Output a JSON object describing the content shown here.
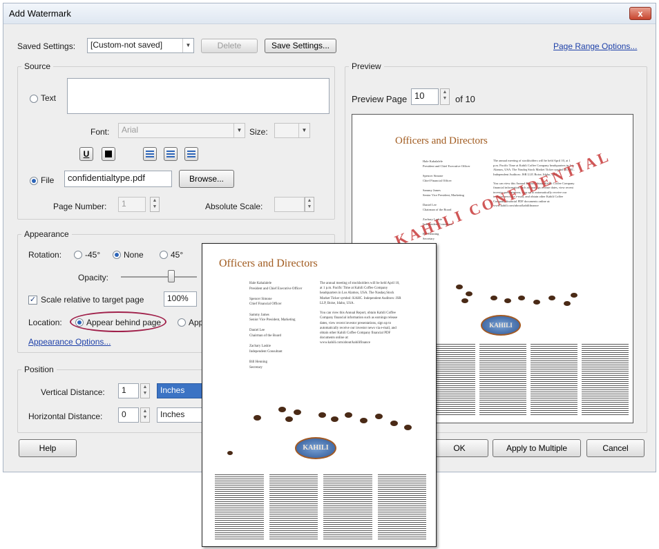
{
  "window": {
    "title": "Add Watermark",
    "close_glyph": "x"
  },
  "saved_settings": {
    "label": "Saved Settings:",
    "value": "[Custom-not saved]",
    "delete_label": "Delete",
    "save_label": "Save Settings..."
  },
  "page_range_link": "Page Range Options...",
  "source": {
    "title": "Source",
    "text_label": "Text",
    "font_label": "Font:",
    "font_value": "Arial",
    "size_label": "Size:",
    "underline_glyph": "U",
    "file_label": "File",
    "file_value": "confidentialtype.pdf",
    "browse_label": "Browse...",
    "page_number_label": "Page Number:",
    "page_number_value": "1",
    "absolute_scale_label": "Absolute Scale:"
  },
  "appearance": {
    "title": "Appearance",
    "rotation_label": "Rotation:",
    "rot_minus45": "-45°",
    "rot_none": "None",
    "rot_45": "45°",
    "opacity_label": "Opacity:",
    "opacity_percent": 15,
    "scale_label": "Scale relative to target page",
    "scale_value": "100%",
    "location_label": "Location:",
    "behind_label": "Appear behind page",
    "on_top_label": "App",
    "options_link": "Appearance Options..."
  },
  "position": {
    "title": "Position",
    "vertical_label": "Vertical Distance:",
    "vertical_value": "1",
    "vertical_unit": "Inches",
    "horizontal_label": "Horizontal Distance:",
    "horizontal_value": "0",
    "horizontal_unit": "Inches"
  },
  "preview": {
    "title": "Preview",
    "page_label": "Preview Page",
    "page_value": "10",
    "of_label": "of 10"
  },
  "doc": {
    "heading": "Officers and Directors",
    "watermark": "KAHILI CONFIDENTIAL",
    "logo": "KAHILI",
    "names": "Hale Kahalalele\nPresident and Chief Executive Officer\n\nSpencer Simone\nChief Financial Officer\n\nSammy James\nSenior Vice President, Marketing\n\nDaniel Lee\nChairman of the Board\n\nZachary Laskie\nIndependent Consultant\n\nBill Henning\nSecretary",
    "notice": "The annual meeting of stockholders will be held April 10, at 1 p.m. Pacific Time at Kahili Coffee Company headquarters in Los Alamos, USA. The Nasdaq Stock Market Ticker symbol: KAHC. Independent Auditors: JSR LLP, Boise, Idaho, USA.\n\nYou can view this Annual Report, obtain Kahili Coffee Company financial information such as earnings release dates, view recent investor presentations, sign up to automatically receive our investor news via e-mail, and obtain other Kahili Coffee Company financial PDF documents online at:\nwww.kahili.com/about/kahilifinance"
  },
  "footer": {
    "help_label": "Help",
    "ok_label": "OK",
    "apply_multiple_label": "Apply to Multiple",
    "cancel_label": "Cancel"
  },
  "colors": {
    "accent": "#2c64b8",
    "link": "#1c3fa8",
    "highlight_ring": "#a0204a",
    "watermark": "#c83a3a",
    "heading": "#a05a1e"
  }
}
